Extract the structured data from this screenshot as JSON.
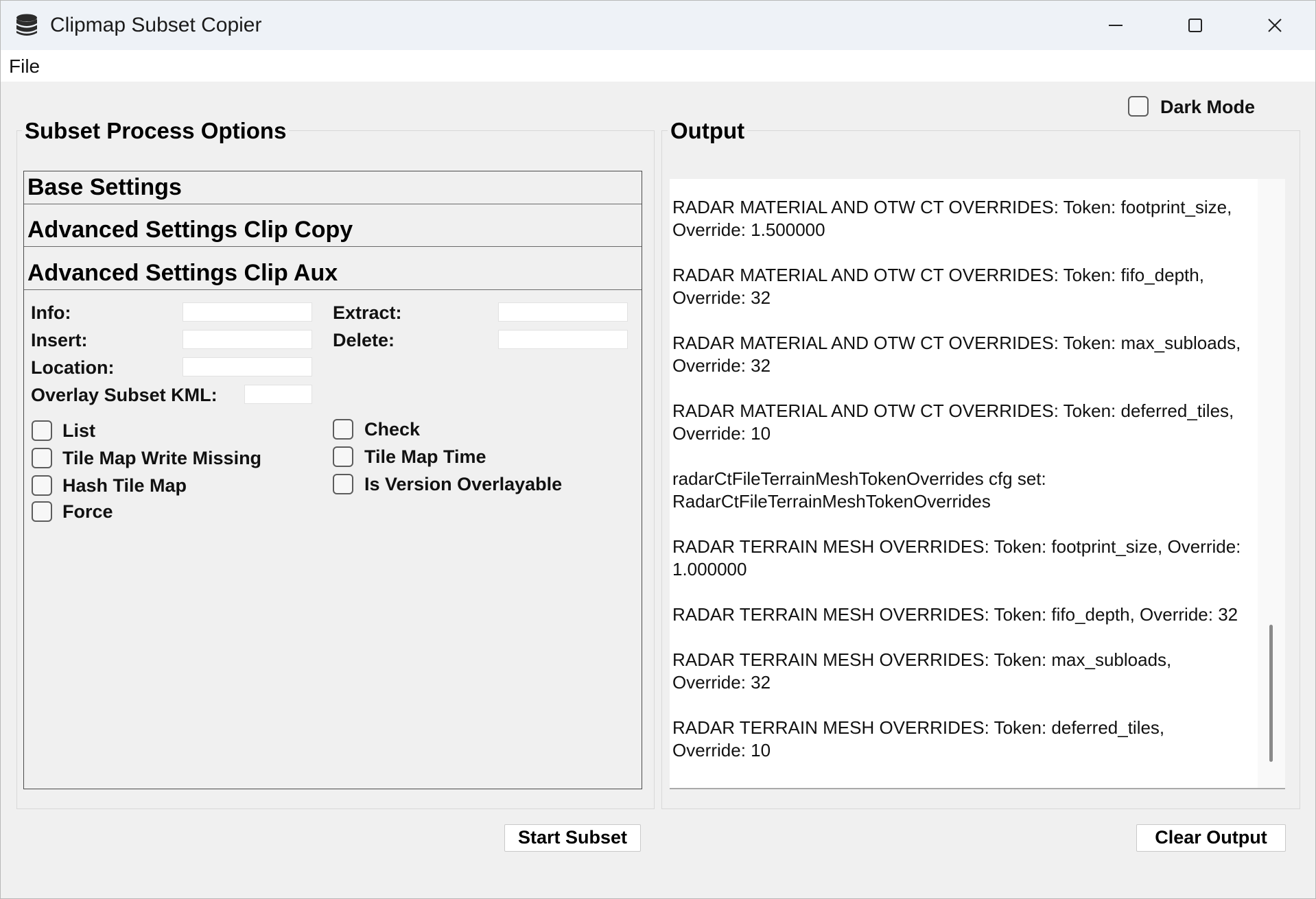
{
  "window": {
    "title": "Clipmap Subset Copier",
    "app_icon": "database-icon",
    "controls": [
      "minimize-icon",
      "maximize-icon",
      "close-icon"
    ]
  },
  "menubar": {
    "file": "File"
  },
  "dark_mode": {
    "label": "Dark Mode",
    "checked": false
  },
  "left_panel": {
    "title": "Subset Process Options",
    "sections": [
      "Base Settings",
      "Advanced Settings Clip Copy",
      "Advanced Settings Clip Aux"
    ],
    "fields": {
      "info": {
        "label": "Info:",
        "value": ""
      },
      "extract": {
        "label": "Extract:",
        "value": ""
      },
      "insert": {
        "label": "Insert:",
        "value": ""
      },
      "delete": {
        "label": "Delete:",
        "value": ""
      },
      "location": {
        "label": "Location:",
        "value": ""
      },
      "overlay_kml": {
        "label": "Overlay Subset KML:",
        "value": ""
      }
    },
    "checkboxes": {
      "list": {
        "label": "List",
        "checked": false
      },
      "check": {
        "label": "Check",
        "checked": false
      },
      "tile_map_write_missing": {
        "label": "Tile Map Write Missing",
        "checked": false
      },
      "tile_map_time": {
        "label": "Tile Map Time",
        "checked": false
      },
      "hash_tile_map": {
        "label": "Hash Tile Map",
        "checked": false
      },
      "is_version_overlayable": {
        "label": "Is Version Overlayable",
        "checked": false
      },
      "force": {
        "label": "Force",
        "checked": false
      }
    },
    "start_button": "Start Subset"
  },
  "right_panel": {
    "title": "Output",
    "lines": [
      "RADAR MATERIAL AND OTW CT OVERRIDES: Token: footprint_size, Override: 1.500000",
      "RADAR MATERIAL AND OTW CT OVERRIDES: Token: fifo_depth, Override: 32",
      "RADAR MATERIAL AND OTW CT OVERRIDES: Token: max_subloads, Override: 32",
      "RADAR MATERIAL AND OTW CT OVERRIDES: Token: deferred_tiles, Override: 10",
      "radarCtFileTerrainMeshTokenOverrides cfg set: RadarCtFileTerrainMeshTokenOverrides",
      "RADAR TERRAIN MESH OVERRIDES: Token: footprint_size, Override: 1.000000",
      "RADAR TERRAIN MESH OVERRIDES: Token: fifo_depth, Override: 32",
      "RADAR TERRAIN MESH OVERRIDES: Token: max_subloads, Override: 32",
      "RADAR TERRAIN MESH OVERRIDES: Token: deferred_tiles, Override: 10"
    ],
    "clear_button": "Clear Output"
  }
}
